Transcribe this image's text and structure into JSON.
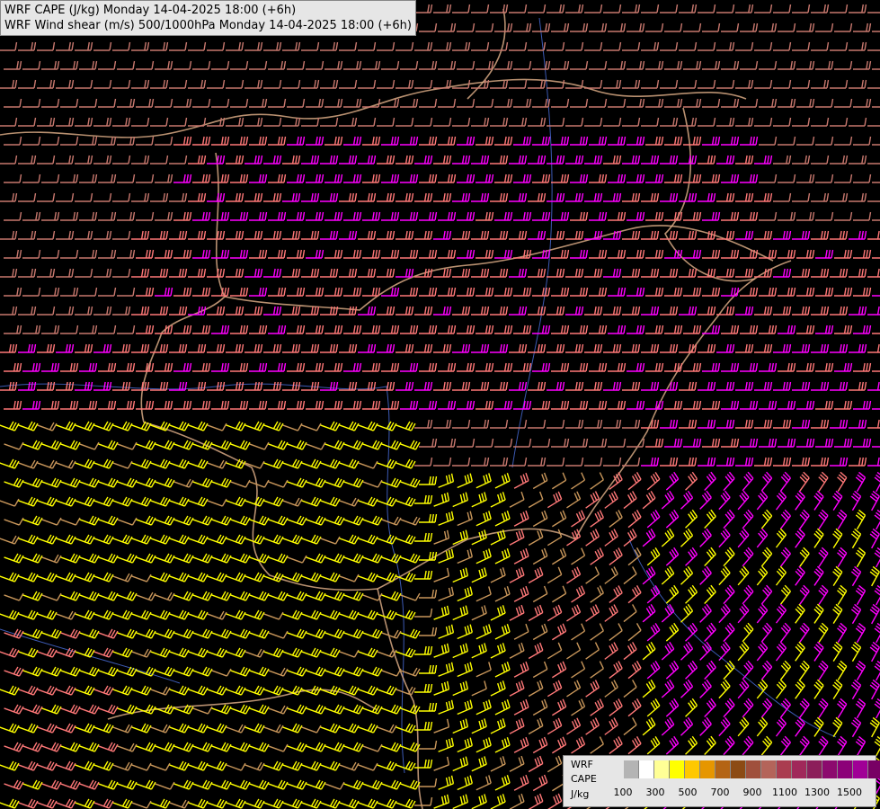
{
  "title": {
    "line1": "WRF CAPE (J/kg) Monday 14-04-2025 18:00 (+6h)",
    "line2": "WRF Wind shear (m/s) 500/1000hPa Monday 14-04-2025 18:00 (+6h)"
  },
  "legend": {
    "label1": "WRF",
    "label2": "CAPE",
    "unit": "J/kg",
    "ticks": [
      "100",
      "300",
      "500",
      "700",
      "900",
      "1100",
      "1300",
      "1500"
    ],
    "colors": [
      "#b4b4b4",
      "#ffffff",
      "#ffff96",
      "#ffff00",
      "#ffc800",
      "#e69600",
      "#b46414",
      "#8c4b14",
      "#a0503c",
      "#b4645a",
      "#aa3c50",
      "#a0285a",
      "#8c1e5a",
      "#8c0a6e",
      "#8c0078",
      "#a00096",
      "#780064"
    ]
  },
  "map": {
    "field_colors": {
      "background": "#000000",
      "barb_weak": "#c8786e",
      "barb_moderate": "#ff7878",
      "barb_strong": "#ff00ff",
      "barb_cape": "#ffff00",
      "barb_brown": "#c8965a",
      "border": "#e6b48c",
      "river": "#3c5ab4"
    }
  }
}
